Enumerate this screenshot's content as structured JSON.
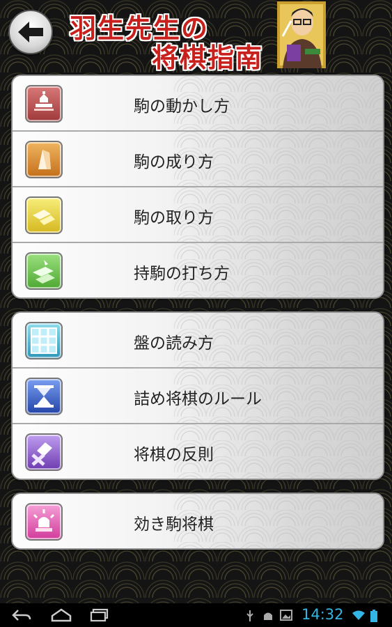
{
  "header": {
    "title_line1": "羽生先生の",
    "title_line2": "将棋指南"
  },
  "groups": [
    {
      "items": [
        {
          "label": "駒の動かし方",
          "icon": "koma-move-icon",
          "color": "#b84a4a"
        },
        {
          "label": "駒の成り方",
          "icon": "koma-promote-icon",
          "color": "#d98a2b"
        },
        {
          "label": "駒の取り方",
          "icon": "koma-capture-icon",
          "color": "#e6d23a"
        },
        {
          "label": "持駒の打ち方",
          "icon": "koma-drop-icon",
          "color": "#66c24a"
        }
      ]
    },
    {
      "items": [
        {
          "label": "盤の読み方",
          "icon": "board-grid-icon",
          "color": "#4fb6cf"
        },
        {
          "label": "詰め将棋のルール",
          "icon": "hourglass-icon",
          "color": "#3a63c4"
        },
        {
          "label": "将棋の反則",
          "icon": "foul-icon",
          "color": "#8b5cc8"
        }
      ]
    },
    {
      "items": [
        {
          "label": "効き駒将棋",
          "icon": "alarm-koma-icon",
          "color": "#e664b8"
        }
      ]
    }
  ],
  "statusbar": {
    "time": "14:32",
    "time_color": "#33b5e5"
  }
}
